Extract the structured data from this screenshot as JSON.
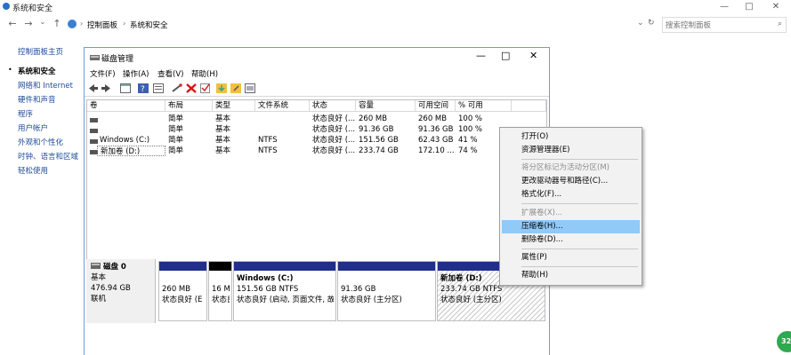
{
  "outer_window": {
    "title": "系统和安全",
    "breadcrumb": [
      "控制面板",
      "系统和安全"
    ],
    "search_placeholder": "搜索控制面板",
    "controls": [
      "—",
      "□",
      "✕"
    ]
  },
  "left_nav": {
    "items": [
      "控制面板主页",
      "系统和安全",
      "网络和 Internet",
      "硬件和声音",
      "程序",
      "用户帐户",
      "外观和个性化",
      "时钟、语言和区域",
      "轻松使用"
    ],
    "active_index": 1
  },
  "disk_mgmt": {
    "title": "磁盘管理",
    "menu": [
      "文件(F)",
      "操作(A)",
      "查看(V)",
      "帮助(H)"
    ],
    "columns": [
      "卷",
      "布局",
      "类型",
      "文件系统",
      "状态",
      "容量",
      "可用空间",
      "% 可用"
    ],
    "rows": [
      {
        "vol": "",
        "layout": "简单",
        "type": "基本",
        "fs": "",
        "status": "状态良好 (...",
        "capacity": "260 MB",
        "free": "260 MB",
        "pct": "100 %"
      },
      {
        "vol": "",
        "layout": "简单",
        "type": "基本",
        "fs": "",
        "status": "状态良好 (...",
        "capacity": "91.36 GB",
        "free": "91.36 GB",
        "pct": "100 %"
      },
      {
        "vol": "Windows (C:)",
        "layout": "简单",
        "type": "基本",
        "fs": "NTFS",
        "status": "状态良好 (...",
        "capacity": "151.56 GB",
        "free": "62.43 GB",
        "pct": "41 %"
      },
      {
        "vol": "新加卷 (D:)",
        "layout": "简单",
        "type": "基本",
        "fs": "NTFS",
        "status": "状态良好 (...",
        "capacity": "233.74 GB",
        "free": "172.10 ...",
        "pct": "74 %"
      }
    ],
    "disk": {
      "name": "磁盘 0",
      "type": "基本",
      "size": "476.94 GB",
      "state": "联机"
    },
    "partitions": [
      {
        "title": "",
        "size": "260 MB",
        "status": "状态良好 (E"
      },
      {
        "title": "",
        "size": "16 M",
        "status": "状态良"
      },
      {
        "title": "Windows  (C:)",
        "size": "151.56 GB NTFS",
        "status": "状态良好 (启动, 页面文件, 故"
      },
      {
        "title": "",
        "size": "91.36 GB",
        "status": "状态良好 (主分区)"
      },
      {
        "title": "新加卷  (D:)",
        "size": "233.74 GB NTFS",
        "status": "状态良好 (主分区)"
      }
    ]
  },
  "context_menu": {
    "items": [
      {
        "label": "打开(O)",
        "enabled": true
      },
      {
        "label": "资源管理器(E)",
        "enabled": true
      },
      {
        "label": "将分区标记为活动分区(M)",
        "enabled": false
      },
      {
        "label": "更改驱动器号和路径(C)...",
        "enabled": true
      },
      {
        "label": "格式化(F)...",
        "enabled": true
      },
      {
        "label": "扩展卷(X)...",
        "enabled": false
      },
      {
        "label": "压缩卷(H)...",
        "enabled": true,
        "highlighted": true
      },
      {
        "label": "删除卷(D)...",
        "enabled": true
      },
      {
        "label": "属性(P)",
        "enabled": true
      },
      {
        "label": "帮助(H)",
        "enabled": true
      }
    ]
  },
  "corner_badge": "32",
  "colors": {
    "accent": "#1e4c9a",
    "highlight": "#91c9f7",
    "partition_bar": "#1f2f8a"
  }
}
